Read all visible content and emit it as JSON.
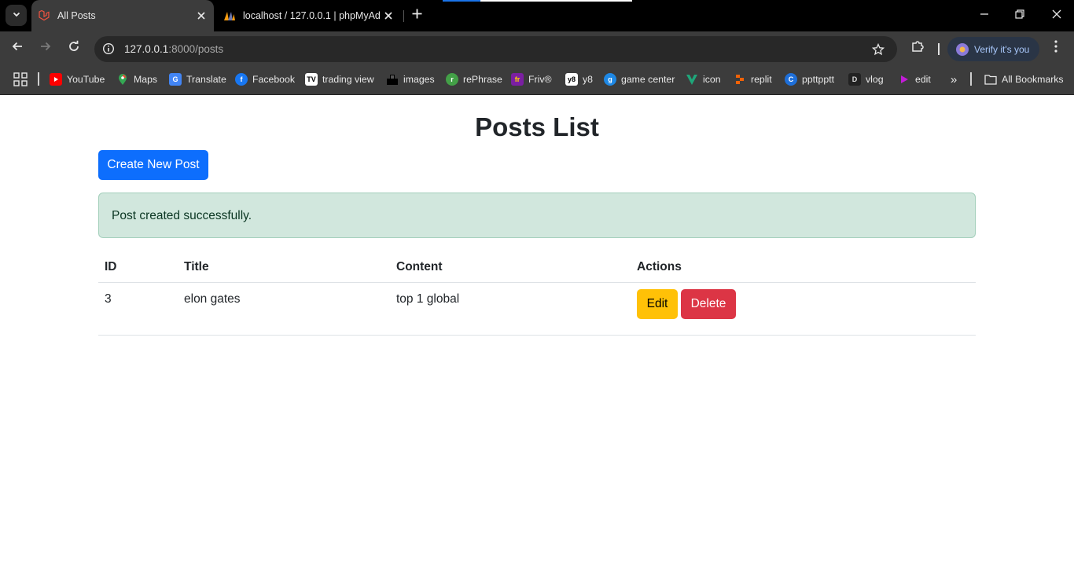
{
  "browser": {
    "tabs": [
      {
        "title": "All Posts",
        "active": true
      },
      {
        "title": "localhost / 127.0.0.1 | phpMyAdmin",
        "active": false
      }
    ],
    "url_host": "127.0.0.1",
    "url_rest": ":8000/posts",
    "profile_label": "Verify it's you",
    "bookmarks": [
      {
        "label": "YouTube",
        "icon": "youtube-icon",
        "color": "#ff0000"
      },
      {
        "label": "Maps",
        "icon": "maps-icon",
        "color": "#34a853"
      },
      {
        "label": "Translate",
        "icon": "translate-icon",
        "color": "#4285f4"
      },
      {
        "label": "Facebook",
        "icon": "facebook-icon",
        "color": "#1877f2"
      },
      {
        "label": "trading view",
        "icon": "tradingview-icon",
        "color": "#ffffff"
      },
      {
        "label": "images",
        "icon": "images-icon",
        "color": "#000000"
      },
      {
        "label": "rePhrase",
        "icon": "rephrase-icon",
        "color": "#43a047"
      },
      {
        "label": "Friv®",
        "icon": "friv-icon",
        "color": "#7b1fa2"
      },
      {
        "label": "y8",
        "icon": "y8-icon",
        "color": "#ffffff"
      },
      {
        "label": "game center",
        "icon": "game-center-icon",
        "color": "#1e88e5"
      },
      {
        "label": "icon",
        "icon": "vuetify-icon",
        "color": "#1fa67a"
      },
      {
        "label": "replit",
        "icon": "replit-icon",
        "color": "#f26207"
      },
      {
        "label": "ppttpptt",
        "icon": "canva-icon",
        "color": "#1e6fd9"
      },
      {
        "label": "vlog",
        "icon": "vlog-icon",
        "color": "#222222"
      },
      {
        "label": "edit",
        "icon": "edit-app-icon",
        "color": "#c21cd6"
      }
    ],
    "all_bookmarks_label": "All Bookmarks"
  },
  "page": {
    "title": "Posts List",
    "create_button": "Create New Post",
    "alert": "Post created successfully.",
    "table": {
      "headers": [
        "ID",
        "Title",
        "Content",
        "Actions"
      ],
      "rows": [
        {
          "id": "3",
          "title": "elon gates",
          "content": "top 1 global",
          "edit": "Edit",
          "delete": "Delete"
        }
      ]
    }
  },
  "colors": {
    "primary": "#0d6efd",
    "success_bg": "#d1e7dd",
    "warning": "#ffc107",
    "danger": "#dc3545"
  }
}
